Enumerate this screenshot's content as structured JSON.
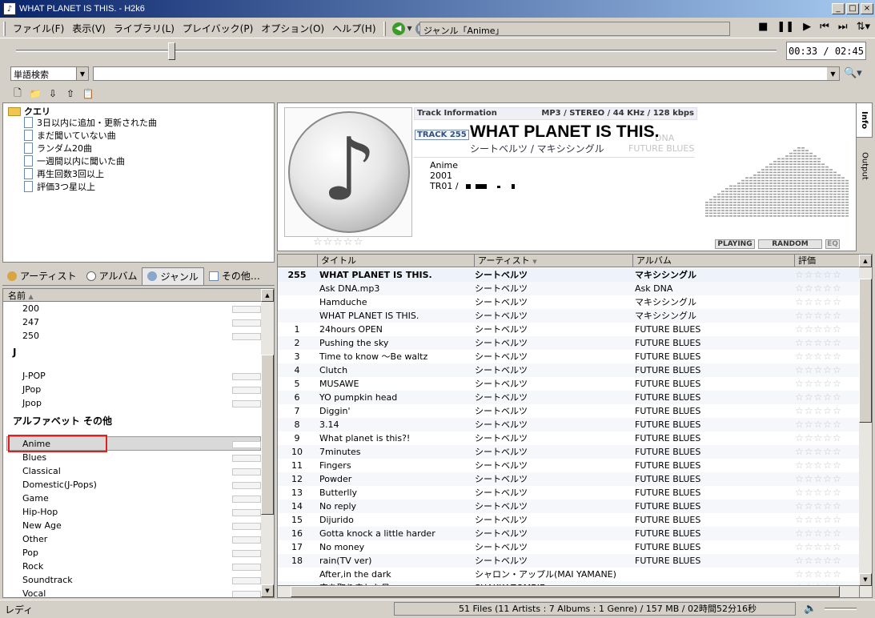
{
  "window": {
    "title": "WHAT PLANET IS THIS. - H2k6",
    "app_icon": "♪"
  },
  "menu": [
    "ファイル(F)",
    "表示(V)",
    "ライブラリ(L)",
    "プレイバック(P)",
    "オプション(O)",
    "ヘルプ(H)"
  ],
  "location": "ジャンル「Anime」",
  "playback": {
    "time": "00:33 / 02:45",
    "position_fraction": 0.2
  },
  "search": {
    "mode": "単語検索",
    "value": ""
  },
  "queries": {
    "root": "クエリ",
    "items": [
      "3日以内に追加・更新された曲",
      "まだ聞いていない曲",
      "ランダム20曲",
      "一週間以内に聞いた曲",
      "再生回数3回以上",
      "評価3つ星以上"
    ]
  },
  "library_tabs": [
    "アーティスト",
    "アルバム",
    "ジャンル",
    "その他…"
  ],
  "genre_list": {
    "column": "名前",
    "numbers": [
      "200",
      "247",
      "250"
    ],
    "group_j": "J",
    "j_items": [
      "J-POP",
      "JPop",
      "Jpop"
    ],
    "group_other": "アルファベット その他",
    "selected": "Anime",
    "other_items": [
      "Blues",
      "Classical",
      "Domestic(J-Pops)",
      "Game",
      "Hip-Hop",
      "New Age",
      "Other",
      "Pop",
      "Rock",
      "Soundtrack",
      "Vocal"
    ]
  },
  "track_info": {
    "header_left": "Track Information",
    "header_right": "MP3 / STEREO / 44 KHz / 128 kbps",
    "badge": "TRACK 255",
    "title": "WHAT PLANET IS THIS.",
    "subtitle": "シートベルツ / マキシシングル",
    "ghost_1": "DNA",
    "ghost_2": "FUTURE BLUES",
    "genre": "Anime",
    "year": "2001",
    "track_prefix": "TR01 /",
    "stars": "☆☆☆☆☆",
    "status": [
      "PLAYING",
      "RANDOM",
      "EQ"
    ],
    "side_tabs": [
      "Info",
      "Output"
    ]
  },
  "tracks": {
    "columns": [
      "タイトル",
      "アーティスト",
      "アルバム",
      "評価"
    ],
    "rating_glyph": "☆☆☆☆☆",
    "rows": [
      {
        "num": "255",
        "title": "WHAT PLANET IS THIS.",
        "artist": "シートベルツ",
        "album": "マキシシングル"
      },
      {
        "num": "",
        "title": "Ask DNA.mp3",
        "artist": "シートベルツ",
        "album": "Ask DNA"
      },
      {
        "num": "",
        "title": "Hamduche",
        "artist": "シートベルツ",
        "album": "マキシシングル"
      },
      {
        "num": "",
        "title": "WHAT PLANET IS THIS.",
        "artist": "シートベルツ",
        "album": "マキシシングル"
      },
      {
        "num": "1",
        "title": "24hours OPEN",
        "artist": "シートベルツ",
        "album": "FUTURE BLUES"
      },
      {
        "num": "2",
        "title": "Pushing the sky",
        "artist": "シートベルツ",
        "album": "FUTURE BLUES"
      },
      {
        "num": "3",
        "title": "Time to know ～Be waltz",
        "artist": "シートベルツ",
        "album": "FUTURE BLUES"
      },
      {
        "num": "4",
        "title": "Clutch",
        "artist": "シートベルツ",
        "album": "FUTURE BLUES"
      },
      {
        "num": "5",
        "title": "MUSAWE",
        "artist": "シートベルツ",
        "album": "FUTURE BLUES"
      },
      {
        "num": "6",
        "title": "YO pumpkin head",
        "artist": "シートベルツ",
        "album": "FUTURE BLUES"
      },
      {
        "num": "7",
        "title": "Diggin'",
        "artist": "シートベルツ",
        "album": "FUTURE BLUES"
      },
      {
        "num": "8",
        "title": "3.14",
        "artist": "シートベルツ",
        "album": "FUTURE BLUES"
      },
      {
        "num": "9",
        "title": "What planet is this?!",
        "artist": "シートベルツ",
        "album": "FUTURE BLUES"
      },
      {
        "num": "10",
        "title": "7minutes",
        "artist": "シートベルツ",
        "album": "FUTURE BLUES"
      },
      {
        "num": "11",
        "title": "Fingers",
        "artist": "シートベルツ",
        "album": "FUTURE BLUES"
      },
      {
        "num": "12",
        "title": "Powder",
        "artist": "シートベルツ",
        "album": "FUTURE BLUES"
      },
      {
        "num": "13",
        "title": "Butterlly",
        "artist": "シートベルツ",
        "album": "FUTURE BLUES"
      },
      {
        "num": "14",
        "title": "No reply",
        "artist": "シートベルツ",
        "album": "FUTURE BLUES"
      },
      {
        "num": "15",
        "title": "Dijurido",
        "artist": "シートベルツ",
        "album": "FUTURE BLUES"
      },
      {
        "num": "16",
        "title": "Gotta knock a little harder",
        "artist": "シートベルツ",
        "album": "FUTURE BLUES"
      },
      {
        "num": "17",
        "title": "No money",
        "artist": "シートベルツ",
        "album": "FUTURE BLUES"
      },
      {
        "num": "18",
        "title": "rain(TV ver)",
        "artist": "シートベルツ",
        "album": "FUTURE BLUES"
      },
      {
        "num": "",
        "title": "After,in the dark",
        "artist": "シャロン・アップル(MAI YAMANE)",
        "album": ""
      },
      {
        "num": "",
        "title": "空を取り戻した日",
        "artist": "SHAKKAZOMBIE",
        "album": ""
      }
    ]
  },
  "status": {
    "left": "レディ",
    "summary": "51 Files (11 Artists : 7 Albums : 1 Genre) / 157 MB / 02時間52分16秒"
  },
  "colors": {
    "title_start": "#0a246a",
    "title_end": "#a6caf0",
    "highlight": "#e02020"
  }
}
